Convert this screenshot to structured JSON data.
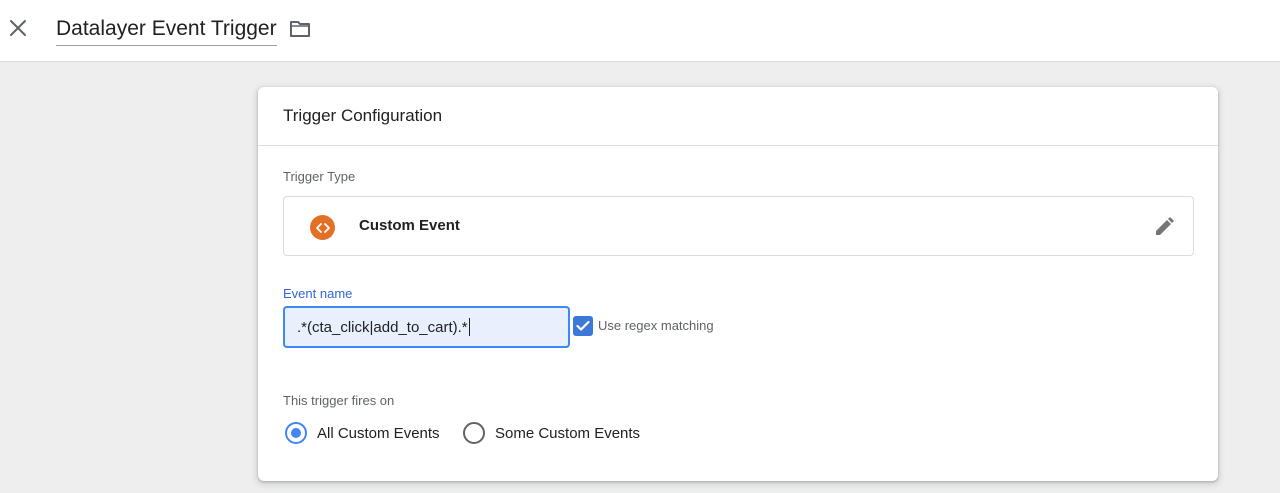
{
  "header": {
    "title": "Datalayer Event Trigger",
    "close_icon": "close-icon",
    "folder_icon": "folder-icon"
  },
  "card": {
    "title": "Trigger Configuration",
    "trigger_type": {
      "label": "Trigger Type",
      "value": "Custom Event",
      "icon": "custom-event-icon",
      "icon_color": "#e37125"
    },
    "event_name": {
      "label": "Event name",
      "value": ".*(cta_click|add_to_cart).*"
    },
    "regex": {
      "label": "Use regex matching",
      "checked": true
    },
    "fires_on": {
      "label": "This trigger fires on",
      "options": [
        {
          "label": "All Custom Events",
          "selected": true
        },
        {
          "label": "Some Custom Events",
          "selected": false
        }
      ]
    }
  },
  "colors": {
    "accent": "#4285f4",
    "checkbox": "#3c78d8",
    "field_label": "#3367d6"
  }
}
